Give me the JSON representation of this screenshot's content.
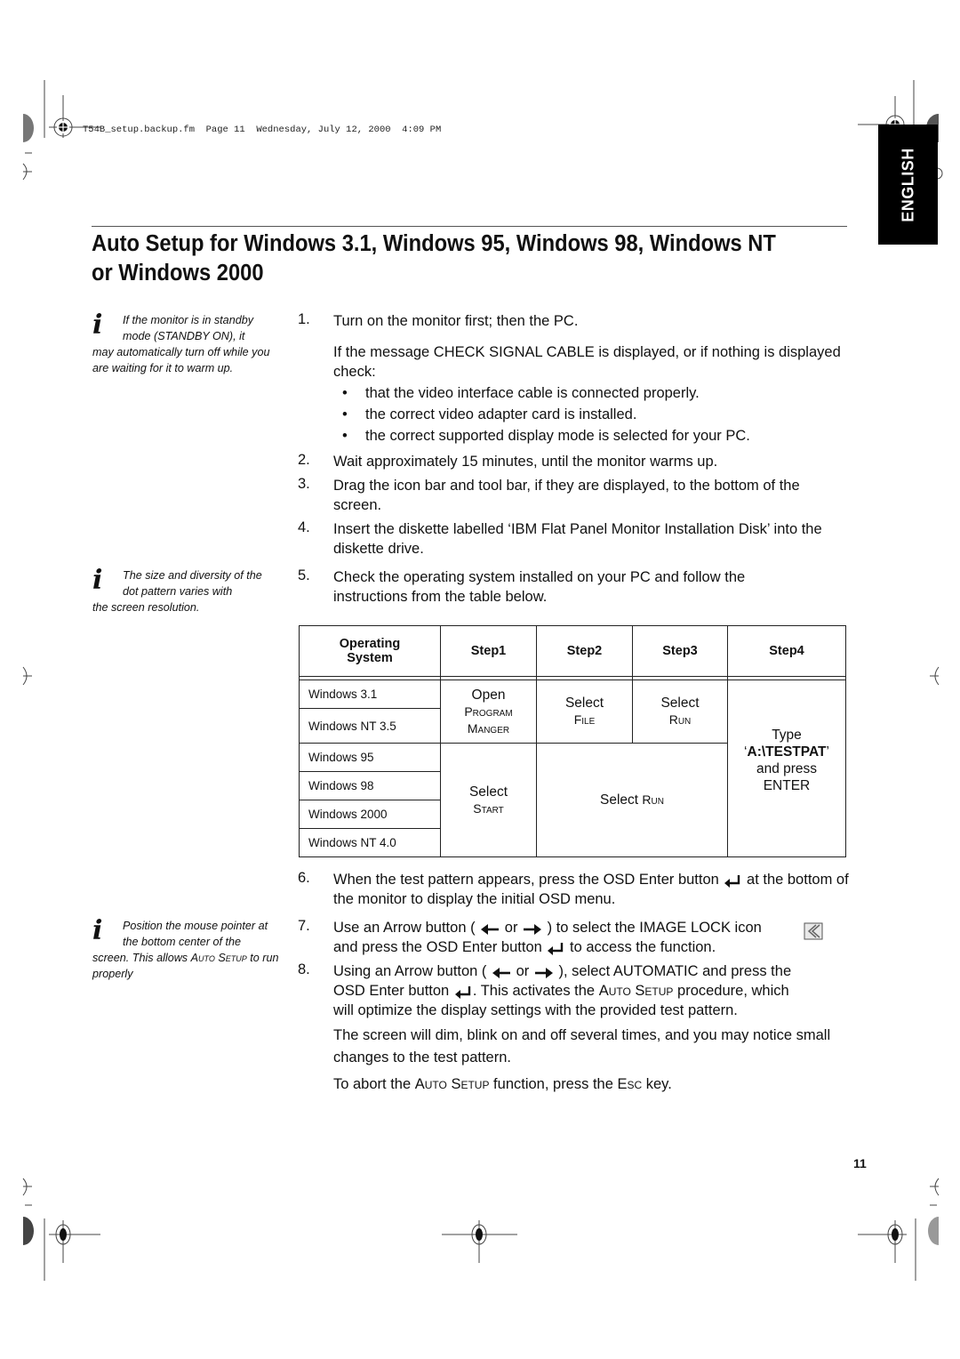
{
  "header": {
    "file_info": "T54B_setup.backup.fm  Page 11  Wednesday, July 12, 2000  4:09 PM"
  },
  "side_tab": {
    "label": "ENGLISH"
  },
  "title": "Auto Setup for Windows 3.1, Windows 95, Windows 98, Windows NT or Windows 2000",
  "notes": [
    {
      "icon": "info-icon",
      "first": "If the monitor is in standby mode (STANDBY ON), it",
      "rest": "may automatically turn off while you are waiting for it to warm up."
    },
    {
      "icon": "info-icon",
      "first": "The size and diversity of the dot pattern varies with",
      "rest": "the screen resolution."
    },
    {
      "icon": "info-icon",
      "first": "Position the mouse pointer at the bottom center of the",
      "rest_a": "screen. This allows ",
      "rest_sc1": "Auto",
      "rest_b": " ",
      "rest_sc2": "Setup",
      "rest_c": " to run properly"
    }
  ],
  "steps": {
    "s1": {
      "num": "1.",
      "text": "Turn on the monitor first; then the PC."
    },
    "s1_para": "If the message CHECK SIGNAL CABLE is displayed, or if nothing is displayed check:",
    "bullets": [
      "that the video interface cable is connected properly.",
      "the correct video adapter card is installed.",
      "the correct supported display mode is selected for your PC."
    ],
    "s2": {
      "num": "2.",
      "text": "Wait approximately 15 minutes, until the monitor warms up."
    },
    "s3": {
      "num": "3.",
      "text": "Drag the icon bar and tool bar, if they are displayed, to the bottom of the screen."
    },
    "s4": {
      "num": "4.",
      "text": "Insert the diskette labelled ‘IBM Flat Panel Monitor Installation Disk’ into the diskette drive."
    },
    "s5": {
      "num": "5.",
      "text": "Check the operating system installed on your PC and follow the instructions from the table below."
    },
    "s6": {
      "num": "6.",
      "a": "When the test pattern appears, press the OSD Enter button",
      "b": "at the bottom of the monitor to display the initial OSD menu."
    },
    "s7": {
      "num": "7.",
      "a": "Use an Arrow button (",
      "or": "or",
      "b": ") to select the IMAGE LOCK icon",
      "c": "and press the OSD Enter button",
      "d": "to access the function."
    },
    "s8": {
      "num": "8.",
      "a": "Using an Arrow button (",
      "or": "or",
      "b": "), select AUTOMATIC and press the",
      "c": "OSD Enter button",
      "d": ". This activates the ",
      "sc1": "Auto",
      "sp": " ",
      "sc2": "Setup",
      "e": " procedure, which",
      "f": "will optimize the display settings with the provided test pattern."
    },
    "after1": "The screen will dim, blink on and off several times, and you may notice small changes to the test pattern.",
    "after2": {
      "a": "To abort the ",
      "sc1": "Auto",
      "sp": " ",
      "sc2": "Setup",
      "b": " function, press the ",
      "sc3": "Esc",
      "c": " key."
    }
  },
  "table": {
    "headers": [
      "Operating System",
      "Step1",
      "Step2",
      "Step3",
      "Step4"
    ],
    "header_os_line1": "Operating",
    "header_os_line2": "System",
    "group1": {
      "os": [
        "Windows 3.1",
        "Windows NT 3.5"
      ],
      "step1_line1": "Open",
      "step1_sc1": "Program",
      "step1_sc2": "Manger",
      "step2_line1": "Select",
      "step2_sc": "File",
      "step3_line1": "Select",
      "step3_sc": "Run"
    },
    "group2": {
      "os": [
        "Windows 95",
        "Windows 98",
        "Windows 2000",
        "Windows NT 4.0"
      ],
      "step1_line1": "Select",
      "step1_sc": "Start",
      "step23_a": "Select ",
      "step23_sc": "Run"
    },
    "step4": {
      "line1": "Type",
      "q_open": "‘",
      "cmd": "A:\\TESTPAT",
      "q_close": "’",
      "line3": "and press",
      "line4": "ENTER"
    }
  },
  "page_number": "11"
}
